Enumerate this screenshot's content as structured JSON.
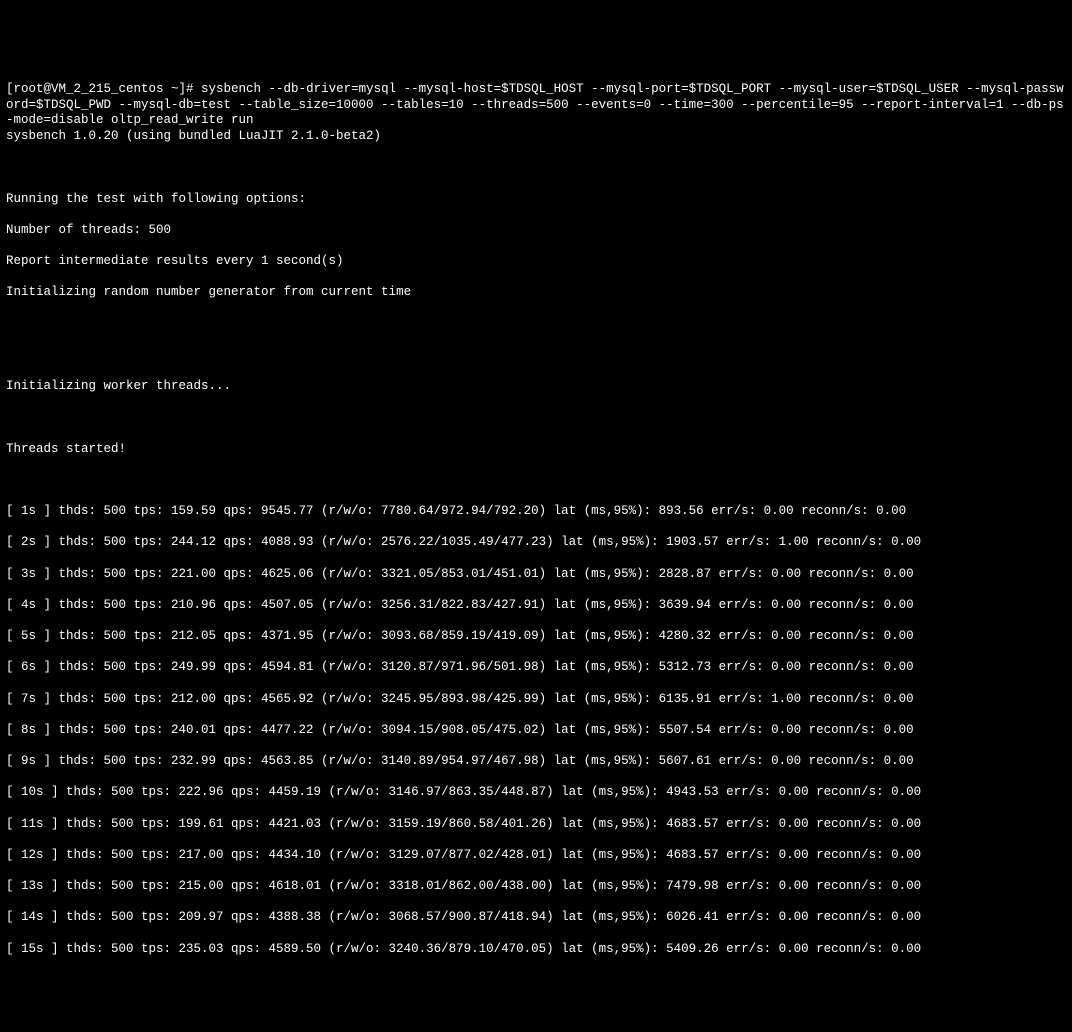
{
  "prompt": "[root@VM_2_215_centos ~]# ",
  "command": "sysbench --db-driver=mysql --mysql-host=$TDSQL_HOST --mysql-port=$TDSQL_PORT --mysql-user=$TDSQL_USER --mysql-password=$TDSQL_PWD --mysql-db=test --table_size=10000 --tables=10 --threads=500 --events=0 --time=300 --percentile=95 --report-interval=1 --db-ps-mode=disable oltp_read_write run",
  "version_line": "sysbench 1.0.20 (using bundled LuaJIT 2.1.0-beta2)",
  "header": {
    "l1": "Running the test with following options:",
    "l2": "Number of threads: 500",
    "l3": "Report intermediate results every 1 second(s)",
    "l4": "Initializing random number generator from current time"
  },
  "init_workers": "Initializing worker threads...",
  "threads_started": "Threads started!",
  "rows": [
    "[ 1s ] thds: 500 tps: 159.59 qps: 9545.77 (r/w/o: 7780.64/972.94/792.20) lat (ms,95%): 893.56 err/s: 0.00 reconn/s: 0.00",
    "[ 2s ] thds: 500 tps: 244.12 qps: 4088.93 (r/w/o: 2576.22/1035.49/477.23) lat (ms,95%): 1903.57 err/s: 1.00 reconn/s: 0.00",
    "[ 3s ] thds: 500 tps: 221.00 qps: 4625.06 (r/w/o: 3321.05/853.01/451.01) lat (ms,95%): 2828.87 err/s: 0.00 reconn/s: 0.00",
    "[ 4s ] thds: 500 tps: 210.96 qps: 4507.05 (r/w/o: 3256.31/822.83/427.91) lat (ms,95%): 3639.94 err/s: 0.00 reconn/s: 0.00",
    "[ 5s ] thds: 500 tps: 212.05 qps: 4371.95 (r/w/o: 3093.68/859.19/419.09) lat (ms,95%): 4280.32 err/s: 0.00 reconn/s: 0.00",
    "[ 6s ] thds: 500 tps: 249.99 qps: 4594.81 (r/w/o: 3120.87/971.96/501.98) lat (ms,95%): 5312.73 err/s: 0.00 reconn/s: 0.00",
    "[ 7s ] thds: 500 tps: 212.00 qps: 4565.92 (r/w/o: 3245.95/893.98/425.99) lat (ms,95%): 6135.91 err/s: 1.00 reconn/s: 0.00",
    "[ 8s ] thds: 500 tps: 240.01 qps: 4477.22 (r/w/o: 3094.15/908.05/475.02) lat (ms,95%): 5507.54 err/s: 0.00 reconn/s: 0.00",
    "[ 9s ] thds: 500 tps: 232.99 qps: 4563.85 (r/w/o: 3140.89/954.97/467.98) lat (ms,95%): 5607.61 err/s: 0.00 reconn/s: 0.00",
    "[ 10s ] thds: 500 tps: 222.96 qps: 4459.19 (r/w/o: 3146.97/863.35/448.87) lat (ms,95%): 4943.53 err/s: 0.00 reconn/s: 0.00",
    "[ 11s ] thds: 500 tps: 199.61 qps: 4421.03 (r/w/o: 3159.19/860.58/401.26) lat (ms,95%): 4683.57 err/s: 0.00 reconn/s: 0.00",
    "[ 12s ] thds: 500 tps: 217.00 qps: 4434.10 (r/w/o: 3129.07/877.02/428.01) lat (ms,95%): 4683.57 err/s: 0.00 reconn/s: 0.00",
    "[ 13s ] thds: 500 tps: 215.00 qps: 4618.01 (r/w/o: 3318.01/862.00/438.00) lat (ms,95%): 7479.98 err/s: 0.00 reconn/s: 0.00",
    "[ 14s ] thds: 500 tps: 209.97 qps: 4388.38 (r/w/o: 3068.57/900.87/418.94) lat (ms,95%): 6026.41 err/s: 0.00 reconn/s: 0.00",
    "[ 15s ] thds: 500 tps: 235.03 qps: 4589.50 (r/w/o: 3240.36/879.10/470.05) lat (ms,95%): 5409.26 err/s: 0.00 reconn/s: 0.00"
  ]
}
